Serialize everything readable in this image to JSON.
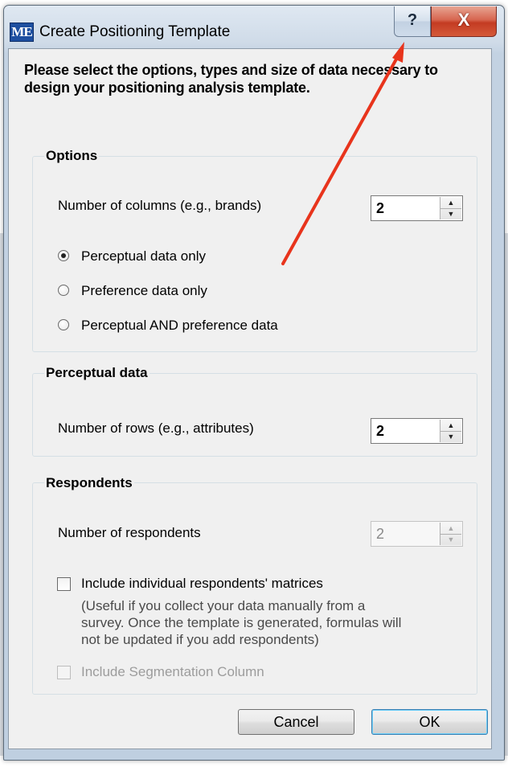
{
  "window": {
    "title": "Create Positioning Template",
    "app_icon_text": "ME",
    "help_symbol": "?",
    "close_symbol": "X"
  },
  "intro": "Please select the options, types and size of data necessary to design your positioning analysis template.",
  "options": {
    "title": "Options",
    "columns_label": "Number of columns (e.g., brands)",
    "columns_value": "2",
    "radios": [
      {
        "label": "Perceptual data only",
        "checked": true
      },
      {
        "label": "Preference data only",
        "checked": false
      },
      {
        "label": "Perceptual AND preference data",
        "checked": false
      }
    ]
  },
  "perceptual": {
    "title": "Perceptual data",
    "rows_label": "Number of rows (e.g., attributes)",
    "rows_value": "2"
  },
  "respondents": {
    "title": "Respondents",
    "count_label": "Number of respondents",
    "count_value": "2",
    "include_matrices_label": "Include individual respondents' matrices",
    "include_matrices_checked": false,
    "note_lines": [
      "(Useful if you collect your data manually from a",
      "survey. Once the template is generated, formulas will",
      "not be updated if you add respondents)"
    ],
    "segmentation_label": "Include Segmentation Column",
    "segmentation_checked": false
  },
  "buttons": {
    "cancel": "Cancel",
    "ok": "OK"
  },
  "annotation": {
    "arrow_color": "#e8341c"
  }
}
